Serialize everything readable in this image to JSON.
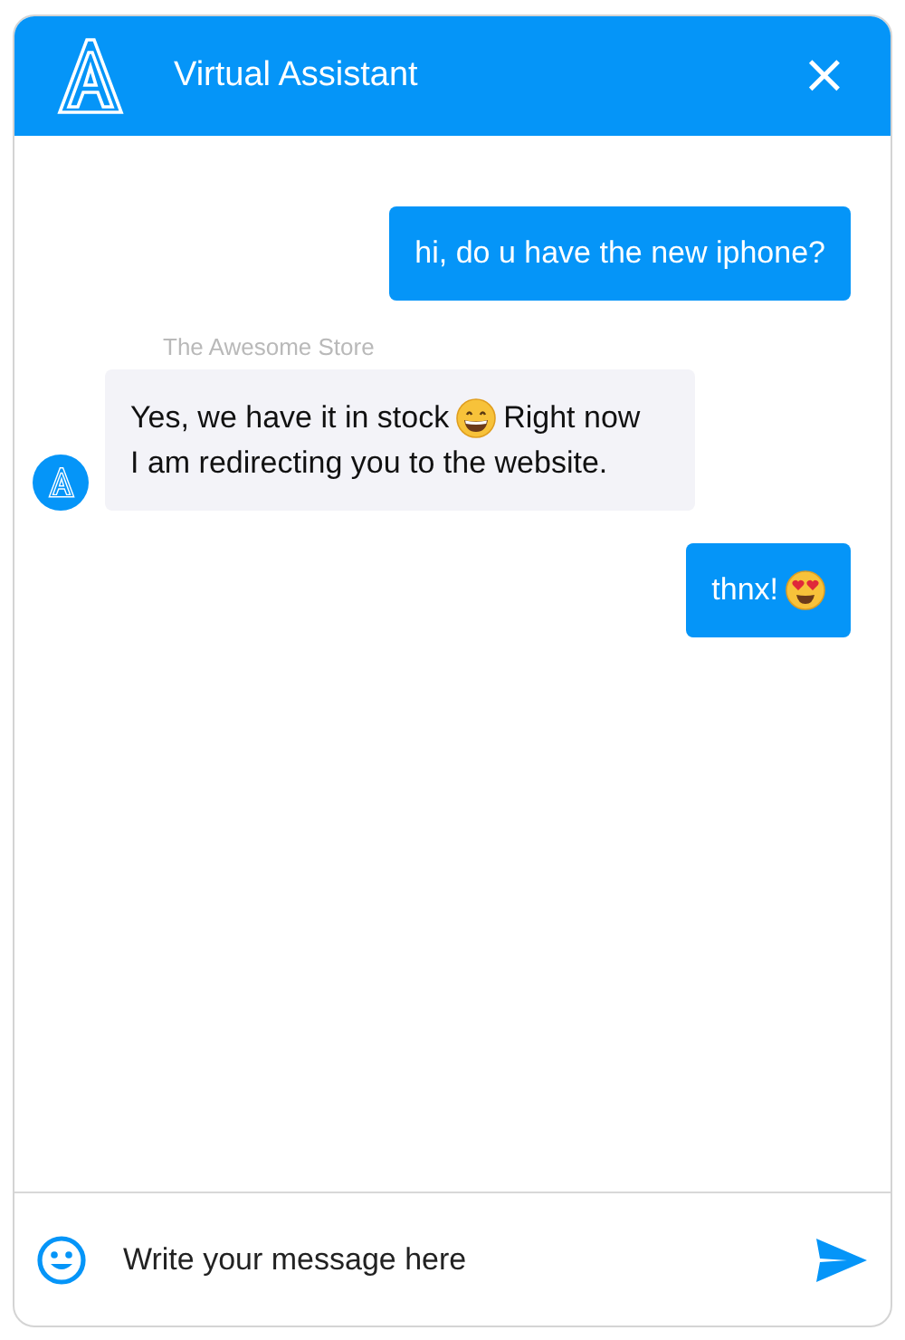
{
  "header": {
    "title": "Virtual Assistant",
    "close": "×"
  },
  "messages": [
    {
      "kind": "user",
      "parts": [
        {
          "kind": "text",
          "text": "hi, do u have the new iphone?"
        }
      ]
    },
    {
      "kind": "bot",
      "sender": "The Awesome Store",
      "parts": [
        {
          "kind": "text",
          "text": "Yes, we have it in stock"
        },
        {
          "kind": "grin"
        },
        {
          "kind": "text",
          "text": "Right now"
        },
        {
          "kind": "break"
        },
        {
          "kind": "text",
          "text": "I am redirecting you to the website."
        }
      ]
    },
    {
      "kind": "user",
      "parts": [
        {
          "kind": "text",
          "text": "thnx!"
        },
        {
          "kind": "hearts"
        }
      ]
    }
  ],
  "composer": {
    "placeholder": "Write your message here"
  }
}
